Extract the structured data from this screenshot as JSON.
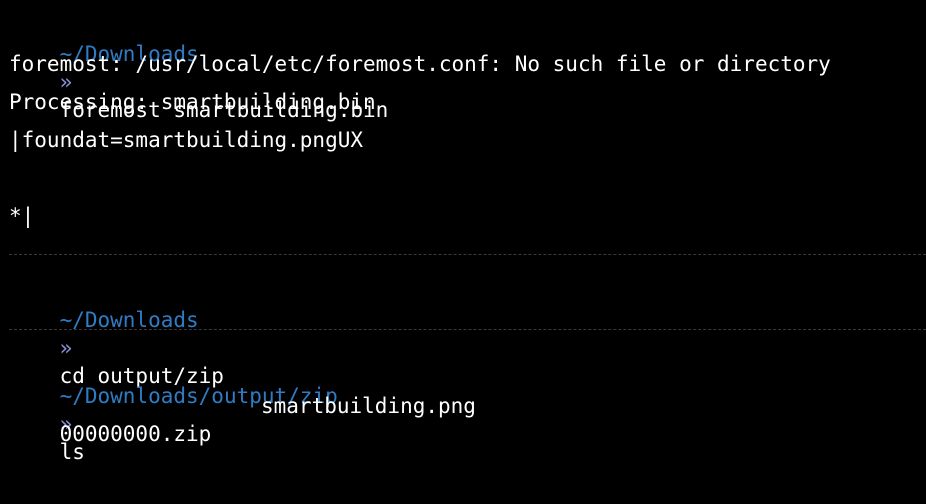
{
  "terminal": {
    "prompt1": {
      "path": "~/Downloads",
      "arrow": "»",
      "command": "foremost smartbuilding.bin"
    },
    "output": [
      "foremost: /usr/local/etc/foremost.conf: No such file or directory",
      "Processing: smartbuilding.bin",
      "|foundat=smartbuilding.pngUX",
      "*|"
    ],
    "prompt2": {
      "path": "~/Downloads",
      "arrow": "»",
      "command": "cd output/zip"
    },
    "prompt3": {
      "path": "~/Downloads/output/zip",
      "arrow": "»",
      "command": "ls"
    },
    "ls_output": [
      "00000000.zip",
      "smartbuilding.png"
    ]
  },
  "colors": {
    "background": "#000000",
    "path": "#2f7cc4",
    "arrow": "#8c8fd8",
    "text": "#ffffff",
    "separator": "#3a3a3a"
  }
}
